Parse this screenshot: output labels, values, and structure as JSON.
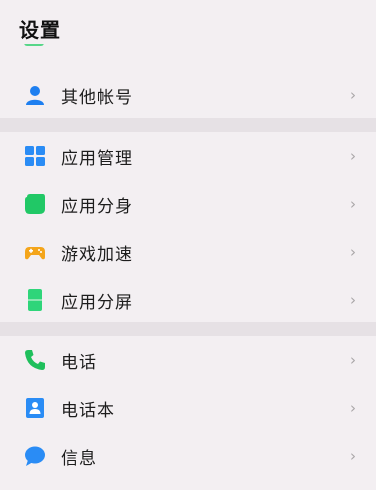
{
  "header": {
    "title": "设置"
  },
  "groups": [
    {
      "items": [
        {
          "label": "其他帐号",
          "icon": "person-icon",
          "color": "#1e7ff0"
        }
      ]
    },
    {
      "items": [
        {
          "label": "应用管理",
          "icon": "grid-icon",
          "color": "#2a8cf5"
        },
        {
          "label": "应用分身",
          "icon": "leaf-icon",
          "color": "#21c866"
        },
        {
          "label": "游戏加速",
          "icon": "gamepad-icon",
          "color": "#f4a51b"
        },
        {
          "label": "应用分屏",
          "icon": "split-screen-icon",
          "color": "#2fd57a"
        }
      ]
    },
    {
      "items": [
        {
          "label": "电话",
          "icon": "phone-icon",
          "color": "#1fbf5c"
        },
        {
          "label": "电话本",
          "icon": "contacts-icon",
          "color": "#2a8cf5"
        },
        {
          "label": "信息",
          "icon": "message-icon",
          "color": "#2a8cf5"
        }
      ]
    }
  ],
  "chevron": "›"
}
